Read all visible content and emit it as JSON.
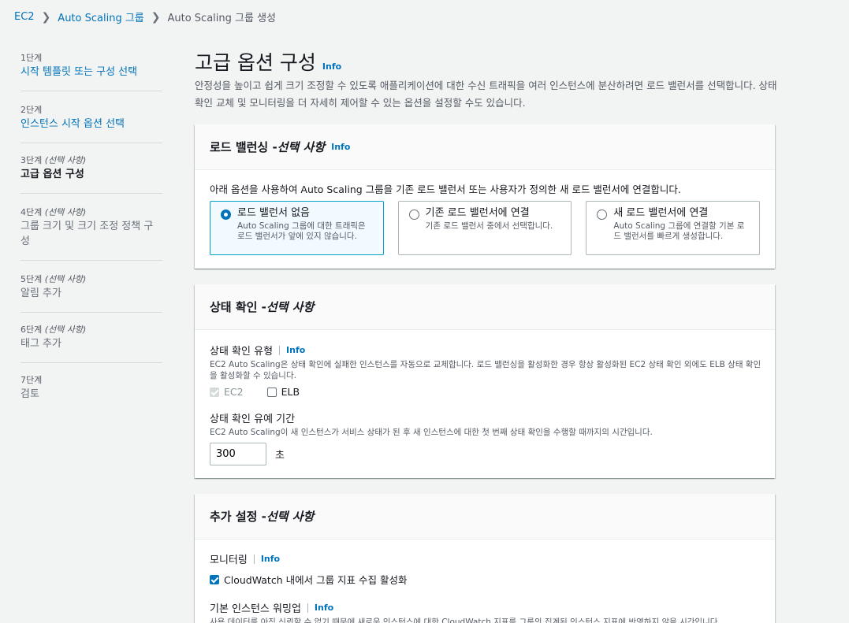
{
  "breadcrumb": [
    "EC2",
    "Auto Scaling 그룹",
    "Auto Scaling 그룹 생성"
  ],
  "nav": {
    "steps": [
      {
        "label": "1단계",
        "optional": "",
        "title": "시작 템플릿 또는 구성 선택"
      },
      {
        "label": "2단계",
        "optional": "",
        "title": "인스턴스 시작 옵션 선택"
      },
      {
        "label": "3단계",
        "optional": "(선택 사항)",
        "title": "고급 옵션 구성"
      },
      {
        "label": "4단계",
        "optional": "(선택 사항)",
        "title": "그룹 크기 및 크기 조정 정책 구성"
      },
      {
        "label": "5단계",
        "optional": "(선택 사항)",
        "title": "알림 추가"
      },
      {
        "label": "6단계",
        "optional": "(선택 사항)",
        "title": "태그 추가"
      },
      {
        "label": "7단계",
        "optional": "",
        "title": "검토"
      }
    ]
  },
  "page": {
    "title": "고급 옵션 구성",
    "info": "Info",
    "description": "안정성을 높이고 쉽게 크기 조정할 수 있도록 애플리케이션에 대한 수신 트래픽을 여러 인스턴스에 분산하려면 로드 밸런서를 선택합니다. 상태 확인 교체 및 모니터링을 더 자세히 제어할 수 있는 옵션을 설정할 수도 있습니다."
  },
  "load_balancing": {
    "title": "로드 밸런싱 - ",
    "optional": "선택 사항",
    "info": "Info",
    "description": "아래 옵션을 사용하여 Auto Scaling 그룹을 기존 로드 밸런서 또는 사용자가 정의한 새 로드 밸런서에 연결합니다.",
    "options": [
      {
        "title": "로드 밸런서 없음",
        "desc": "Auto Scaling 그룹에 대한 트래픽은 로드 밸런서가 앞에 있지 않습니다."
      },
      {
        "title": "기존 로드 밸런서에 연결",
        "desc": "기존 로드 밸런서 중에서 선택합니다."
      },
      {
        "title": "새 로드 밸런서에 연결",
        "desc": "Auto Scaling 그룹에 연결할 기본 로드 밸런서를 빠르게 생성합니다."
      }
    ]
  },
  "health": {
    "title": "상태 확인 - ",
    "optional": "선택 사항",
    "type_label": "상태 확인 유형",
    "info": "Info",
    "type_desc": "EC2 Auto Scaling은 상태 확인에 실패한 인스턴스를 자동으로 교체합니다. 로드 밸런싱을 활성화한 경우 항상 활성화된 EC2 상태 확인 외에도 ELB 상태 확인을 활성화할 수 있습니다.",
    "ec2": "EC2",
    "elb": "ELB",
    "grace_label": "상태 확인 유예 기간",
    "grace_desc": "EC2 Auto Scaling이 새 인스턴스가 서비스 상태가 된 후 새 인스턴스에 대한 첫 번째 상태 확인을 수행할 때까지의 시간입니다.",
    "grace_value": "300",
    "unit": "초"
  },
  "additional": {
    "title": "추가 설정 - ",
    "optional": "선택 사항",
    "monitoring_label": "모니터링",
    "info": "Info",
    "cloudwatch": "CloudWatch 내에서 그룹 지표 수집 활성화",
    "warmup_label": "기본 인스턴스 워밍업",
    "warmup_desc": "사용 데이터를 아직 신뢰할 수 없기 때문에 새로운 인스턴스에 대한 CloudWatch 지표를 그룹의 집계된 인스턴스 지표에 반영하지 않을 시간입니다."
  }
}
